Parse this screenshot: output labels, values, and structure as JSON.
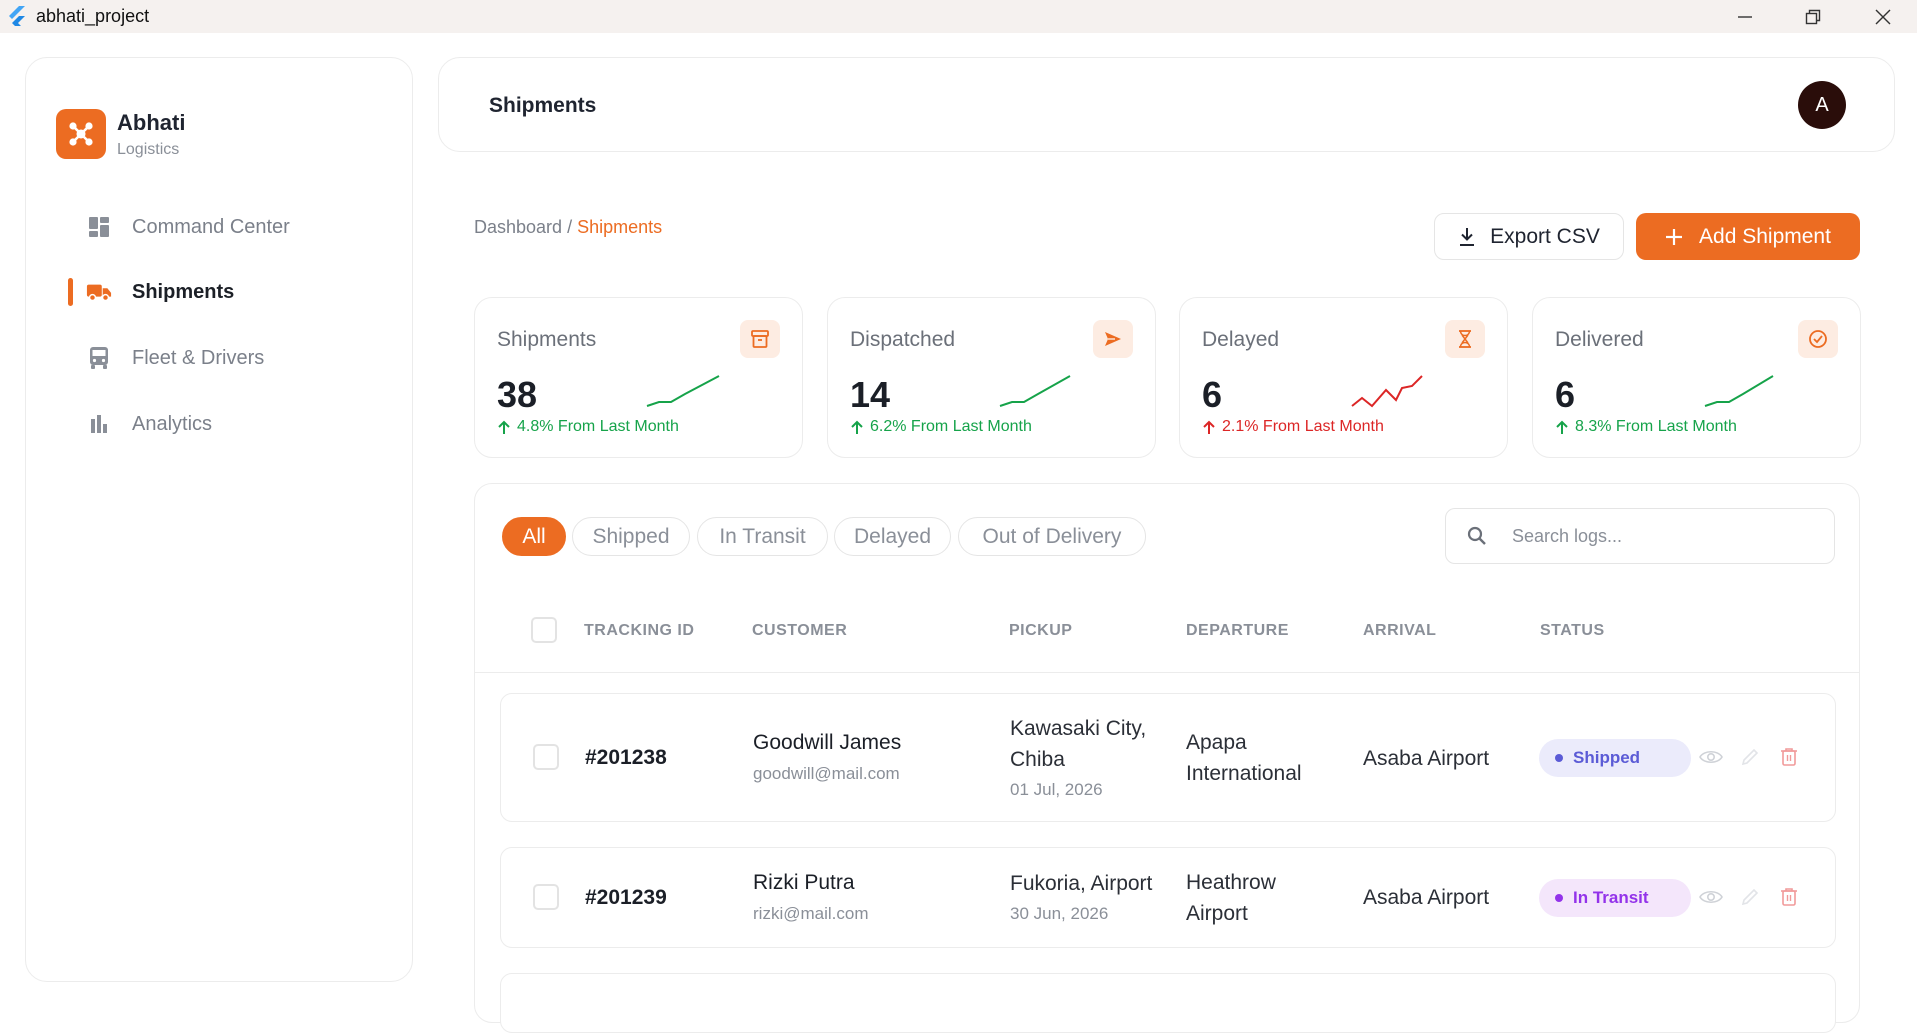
{
  "window": {
    "title": "abhati_project"
  },
  "brand": {
    "name": "Abhati",
    "subtitle": "Logistics"
  },
  "nav": [
    {
      "label": "Command Center",
      "icon": "dashboard-icon"
    },
    {
      "label": "Shipments",
      "icon": "truck-icon",
      "active": true
    },
    {
      "label": "Fleet & Drivers",
      "icon": "bus-icon"
    },
    {
      "label": "Analytics",
      "icon": "bar-chart-icon"
    }
  ],
  "header": {
    "title": "Shipments",
    "avatar_initial": "A"
  },
  "breadcrumb": {
    "root": "Dashboard",
    "sep": " / ",
    "current": "Shipments"
  },
  "actions": {
    "export_label": "Export CSV",
    "add_label": "Add Shipment"
  },
  "stats": [
    {
      "label": "Shipments",
      "value": "38",
      "change": "4.8% From Last Month",
      "trend": "up",
      "icon": "archive-box-icon"
    },
    {
      "label": "Dispatched",
      "value": "14",
      "change": "6.2% From Last Month",
      "trend": "up",
      "icon": "paper-plane-icon"
    },
    {
      "label": "Delayed",
      "value": "6",
      "change": "2.1% From Last Month",
      "trend": "down",
      "icon": "hourglass-icon"
    },
    {
      "label": "Delivered",
      "value": "6",
      "change": "8.3% From Last Month",
      "trend": "up",
      "icon": "check-circle-icon"
    }
  ],
  "filters": [
    "All",
    "Shipped",
    "In Transit",
    "Delayed",
    "Out of Delivery"
  ],
  "search": {
    "placeholder": "Search logs..."
  },
  "table": {
    "columns": [
      "TRACKING ID",
      "CUSTOMER",
      "PICKUP",
      "DEPARTURE",
      "ARRIVAL",
      "STATUS"
    ],
    "rows": [
      {
        "tracking_id": "#201238",
        "customer": "Goodwill James",
        "email": "goodwill@mail.com",
        "pickup_line1": "Kawasaki City,",
        "pickup_line2": "Chiba",
        "pickup_date": "01 Jul, 2026",
        "departure_line1": "Apapa",
        "departure_line2": "International",
        "arrival": "Asaba Airport",
        "status": "Shipped"
      },
      {
        "tracking_id": "#201239",
        "customer": "Rizki Putra",
        "email": "rizki@mail.com",
        "pickup_line1": "Fukoria, Airport",
        "pickup_date": "30 Jun, 2026",
        "departure_line1": "Heathrow",
        "departure_line2": "Airport",
        "arrival": "Asaba Airport",
        "status": "In Transit"
      }
    ]
  },
  "colors": {
    "accent": "#ec6c22",
    "positive": "#16a34a",
    "negative": "#dc2626",
    "shipped_badge_bg": "#ebebfb",
    "shipped_badge_fg": "#5b5bd6",
    "transit_badge_bg": "#f4e6fb",
    "transit_badge_fg": "#9333ea"
  }
}
